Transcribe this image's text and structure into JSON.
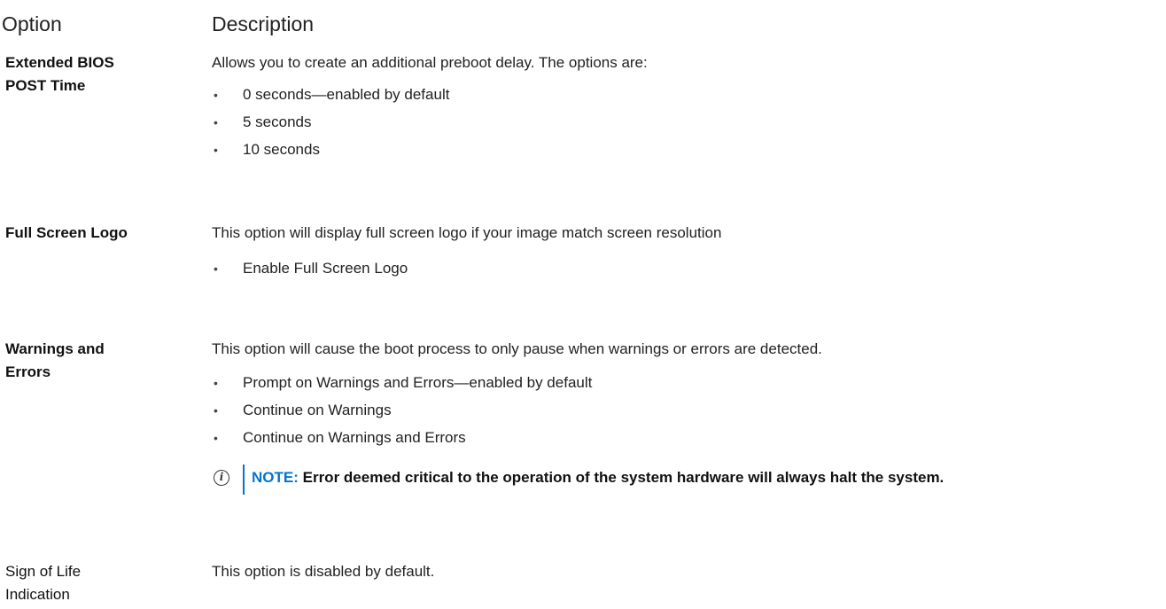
{
  "header": {
    "option_label": "Option",
    "description_label": "Description"
  },
  "rows": [
    {
      "option": [
        "Extended BIOS",
        "POST Time"
      ],
      "description": "Allows you to create an additional preboot delay. The options are:",
      "bullets": [
        "0 seconds—enabled by default",
        "5 seconds",
        "10 seconds"
      ]
    },
    {
      "option": [
        "Full Screen Logo"
      ],
      "description": "This option will display full screen logo if your image match screen resolution",
      "bullets": [
        "Enable Full Screen Logo"
      ]
    },
    {
      "option": [
        "Warnings and",
        "Errors"
      ],
      "description": "This option will cause the boot process to only pause when warnings or errors are detected.",
      "bullets": [
        "Prompt on Warnings and Errors—enabled by default",
        "Continue on Warnings",
        "Continue on Warnings and Errors"
      ],
      "note": {
        "label": "NOTE:",
        "text": " Error deemed critical to the operation of the system hardware will always halt the system."
      }
    },
    {
      "option": [
        "Sign of Life",
        "Indication"
      ],
      "description": "This option is disabled by default.",
      "bullets": []
    }
  ],
  "icons": {
    "bullet": "•",
    "info": "i"
  },
  "colors": {
    "note_accent": "#0076ce"
  }
}
